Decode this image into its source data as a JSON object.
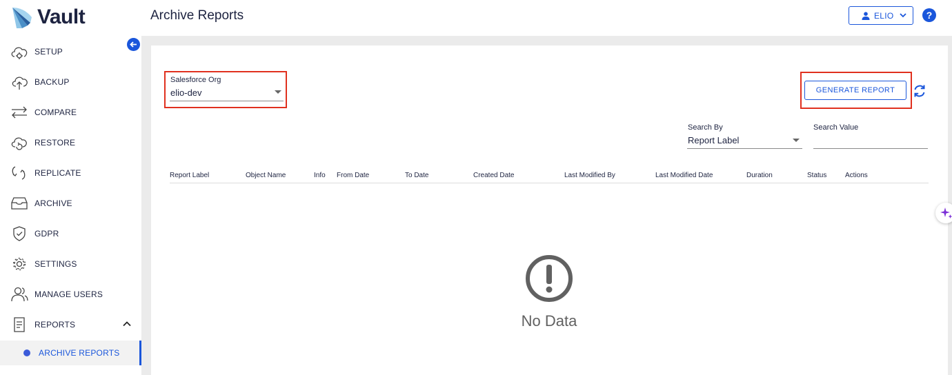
{
  "app": {
    "name": "Vault"
  },
  "header": {
    "title": "Archive Reports",
    "user": "ELIO",
    "help_glyph": "?"
  },
  "sidebar": {
    "items": [
      {
        "label": "SETUP",
        "icon": "cloud-gear-icon"
      },
      {
        "label": "BACKUP",
        "icon": "cloud-upload-icon"
      },
      {
        "label": "COMPARE",
        "icon": "compare-arrows-icon"
      },
      {
        "label": "RESTORE",
        "icon": "cloud-restore-icon"
      },
      {
        "label": "REPLICATE",
        "icon": "replicate-icon"
      },
      {
        "label": "ARCHIVE",
        "icon": "archive-box-icon"
      },
      {
        "label": "GDPR",
        "icon": "shield-check-icon"
      },
      {
        "label": "SETTINGS",
        "icon": "gear-icon"
      },
      {
        "label": "MANAGE USERS",
        "icon": "users-icon"
      },
      {
        "label": "REPORTS",
        "icon": "report-icon",
        "expanded": true
      }
    ],
    "sub_items": [
      {
        "label": "ARCHIVE REPORTS",
        "active": true
      }
    ]
  },
  "filters": {
    "org": {
      "label": "Salesforce Org",
      "value": "elio-dev"
    },
    "generate_label": "GENERATE REPORT",
    "search_by": {
      "label": "Search By",
      "value": "Report Label"
    },
    "search_value": {
      "label": "Search Value",
      "value": ""
    }
  },
  "table": {
    "columns": [
      "Report Label",
      "Object Name",
      "Info",
      "From Date",
      "To Date",
      "Created Date",
      "Last Modified By",
      "Last Modified Date",
      "Duration",
      "Status",
      "Actions"
    ],
    "rows": [],
    "empty_text": "No Data"
  },
  "colors": {
    "accent": "#1a56db",
    "highlight": "#e0301e",
    "navy": "#1d2340"
  }
}
